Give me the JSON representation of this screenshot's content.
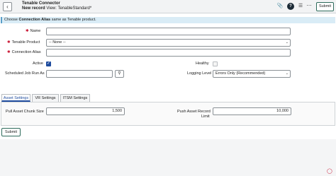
{
  "header": {
    "title": "Tenable Connector",
    "subtitle_bold": "New record",
    "subtitle_view": "View: TenableStandard*",
    "submit_label": "Submit"
  },
  "banner": {
    "prefix": "Choose ",
    "bold": "Connection Alias",
    "suffix": " same as Tenable product."
  },
  "form": {
    "name_label": "Name",
    "name_value": "",
    "product_label": "Tenable Product",
    "product_value": "-- None --",
    "alias_label": "Connection Alias",
    "alias_value": "",
    "active_label": "Active",
    "active_checked": true,
    "healthy_label": "Healthy",
    "healthy_checked": false,
    "job_label": "Scheduled Job Run As",
    "job_value": "",
    "logging_label": "Logging Level",
    "logging_value": "Errors Only (Recommended)"
  },
  "tabs": [
    {
      "label": "Asset Settings",
      "active": true
    },
    {
      "label": "VR Settings",
      "active": false
    },
    {
      "label": "ITSM Settings",
      "active": false
    }
  ],
  "asset_settings": {
    "chunk_label": "Pull Asset Chunk Size",
    "chunk_value": "1,500",
    "limit_label_line1": "Push Asset Record",
    "limit_label_line2": "Limit",
    "limit_value": "10,000"
  },
  "footer": {
    "submit_label": "Submit"
  },
  "colors": {
    "accent": "#1f4c9e",
    "banner_bg": "#d9ecf6",
    "required": "#c8102e"
  }
}
